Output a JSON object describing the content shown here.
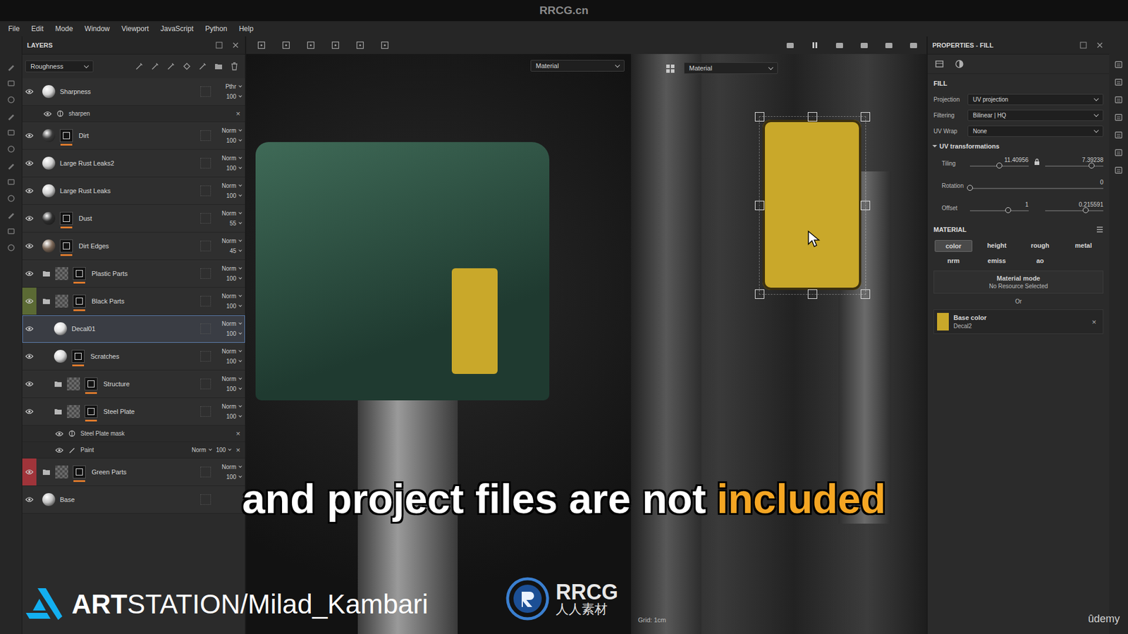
{
  "title_bar": {
    "title": "RRCG.cn"
  },
  "menu": [
    "File",
    "Edit",
    "Mode",
    "Window",
    "Viewport",
    "JavaScript",
    "Python",
    "Help"
  ],
  "layers_panel": {
    "title": "LAYERS",
    "channel": "Roughness",
    "layers": [
      {
        "name": "Sharpness",
        "kind": "fill",
        "depth": 0,
        "blend": "Pthr",
        "opacity": "100",
        "thumb": "#d4d4d4",
        "mask": false,
        "selected": false
      },
      {
        "name": "sharpen",
        "kind": "effect",
        "depth": 1,
        "remove": "×",
        "selected": false
      },
      {
        "name": "Dirt",
        "kind": "fill",
        "depth": 0,
        "blend": "Norm",
        "opacity": "100",
        "thumb": "#3a3a3a",
        "mask": true,
        "selected": false
      },
      {
        "name": "Large Rust Leaks2",
        "kind": "fill",
        "depth": 0,
        "blend": "Norm",
        "opacity": "100",
        "thumb": "#cfcfcf",
        "mask": false,
        "selected": false
      },
      {
        "name": "Large Rust Leaks",
        "kind": "fill",
        "depth": 0,
        "blend": "Norm",
        "opacity": "100",
        "thumb": "#cfcfcf",
        "mask": false,
        "selected": false
      },
      {
        "name": "Dust",
        "kind": "fill",
        "depth": 0,
        "blend": "Norm",
        "opacity": "55",
        "thumb": "#2c2c2c",
        "mask": true,
        "selected": false
      },
      {
        "name": "Dirt Edges",
        "kind": "fill",
        "depth": 0,
        "blend": "Norm",
        "opacity": "45",
        "thumb": "#7a6656",
        "mask": true,
        "selected": false
      },
      {
        "name": "Plastic Parts",
        "kind": "folder",
        "depth": 0,
        "blend": "Norm",
        "opacity": "100",
        "thumb": "#5a5a5a",
        "mask": true,
        "selected": false
      },
      {
        "name": "Black Parts",
        "kind": "folder",
        "depth": 0,
        "blend": "Norm",
        "opacity": "100",
        "thumb": "#5a5a5a",
        "mask": true,
        "selected": false,
        "eye_color": "#5b6a34"
      },
      {
        "name": "Decal01",
        "kind": "fill",
        "depth": 1,
        "blend": "Norm",
        "opacity": "100",
        "thumb": "#e2e2e2",
        "mask": false,
        "selected": true
      },
      {
        "name": "Scratches",
        "kind": "fill",
        "depth": 1,
        "blend": "Norm",
        "opacity": "100",
        "thumb": "#dadada",
        "mask": true,
        "selected": false
      },
      {
        "name": "Structure",
        "kind": "folder",
        "depth": 1,
        "blend": "Norm",
        "opacity": "100",
        "thumb": "#5a5a5a",
        "mask": true,
        "selected": false
      },
      {
        "name": "Steel Plate",
        "kind": "folder",
        "depth": 1,
        "blend": "Norm",
        "opacity": "100",
        "thumb": "#5a5a5a",
        "mask": true,
        "selected": false
      },
      {
        "name": "Steel Plate mask",
        "kind": "effect",
        "depth": 2,
        "remove": "×",
        "selected": false
      },
      {
        "name": "Paint",
        "kind": "paint",
        "depth": 2,
        "blend": "Norm",
        "opacity": "100",
        "remove": "×",
        "selected": false
      },
      {
        "name": "Green Parts",
        "kind": "folder",
        "depth": 0,
        "blend": "Norm",
        "opacity": "100",
        "thumb": "#5a5a5a",
        "mask": true,
        "selected": false,
        "eye_color": "#a0343a"
      },
      {
        "name": "Base",
        "kind": "fill",
        "depth": 0,
        "blend": "",
        "opacity": "",
        "thumb": "#c2c2c2",
        "mask": false,
        "selected": false
      }
    ]
  },
  "viewport": {
    "left_mode": "Material",
    "right_mode": "Material",
    "grid": "Grid: 1cm"
  },
  "properties": {
    "title": "PROPERTIES - FILL",
    "section": "FILL",
    "fields": [
      {
        "label": "Projection",
        "value": "UV projection"
      },
      {
        "label": "Filtering",
        "value": "Bilinear | HQ"
      },
      {
        "label": "UV Wrap",
        "value": "None"
      }
    ],
    "uv": {
      "title": "UV transformations",
      "expanded": true,
      "rows": [
        {
          "label": "Tiling",
          "locked": true,
          "sliders": [
            {
              "value": "11.40956",
              "level": 0.5
            },
            {
              "value": "7.39238",
              "level": 0.8
            }
          ]
        },
        {
          "label": "Rotation",
          "locked": false,
          "sliders": [
            {
              "value": "0",
              "level": 0
            }
          ]
        },
        {
          "label": "Offset",
          "locked": false,
          "sliders": [
            {
              "value": "1",
              "level": 0.65
            },
            {
              "value": "0.215591",
              "level": 0.7
            }
          ]
        }
      ]
    },
    "material": {
      "title": "MATERIAL",
      "channels": [
        {
          "label": "color",
          "selected": true
        },
        {
          "label": "height",
          "selected": false
        },
        {
          "label": "rough",
          "selected": false
        },
        {
          "label": "metal",
          "selected": false
        },
        {
          "label": "nrm",
          "selected": false
        },
        {
          "label": "emiss",
          "selected": false
        },
        {
          "label": "ao",
          "selected": false
        }
      ],
      "mode_title": "Material mode",
      "mode_value": "No Resource Selected",
      "or": "Or",
      "resource": {
        "title": "Base color",
        "name": "Decal2",
        "color": "#c9a82a",
        "remove": "×"
      }
    }
  },
  "overlay": {
    "subtitle": [
      {
        "text": "and project files are not",
        "highlight": false
      },
      {
        "text": "included",
        "highlight": true
      }
    ],
    "credit": {
      "bold": "ART",
      "rest": "STATION/Milad_Kambari"
    },
    "logo": {
      "name": "RRCG",
      "sub": "人人素材"
    },
    "platform": "ûdemy"
  }
}
